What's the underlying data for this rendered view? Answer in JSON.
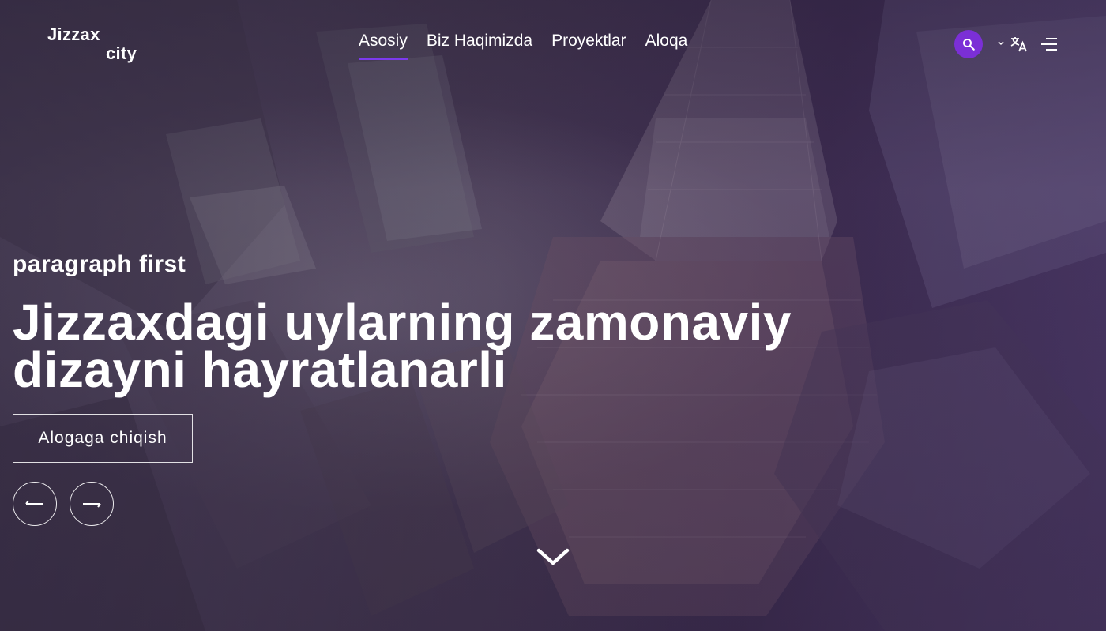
{
  "brand": {
    "line1": "Jizzax",
    "line2": "city"
  },
  "nav": {
    "items": [
      {
        "label": "Asosiy",
        "active": true
      },
      {
        "label": "Biz Haqimizda",
        "active": false
      },
      {
        "label": "Proyektlar",
        "active": false
      },
      {
        "label": "Aloqa",
        "active": false
      }
    ]
  },
  "header_actions": {
    "search_icon": "search-icon",
    "language_icon": "translate-icon",
    "menu_icon": "menu-icon"
  },
  "hero": {
    "subtitle": "paragraph first",
    "title_line1": "Jizzaxdagi uylarning zamonaviy",
    "title_line2": "dizayni hayratlanarli",
    "cta_label": "Alogaga chiqish",
    "prev_icon": "arrow-left-icon",
    "next_icon": "arrow-right-icon",
    "scroll_icon": "chevron-down-icon"
  },
  "colors": {
    "accent": "#7b2fd6",
    "active_underline": "#7c3aed",
    "text": "#ffffff"
  }
}
